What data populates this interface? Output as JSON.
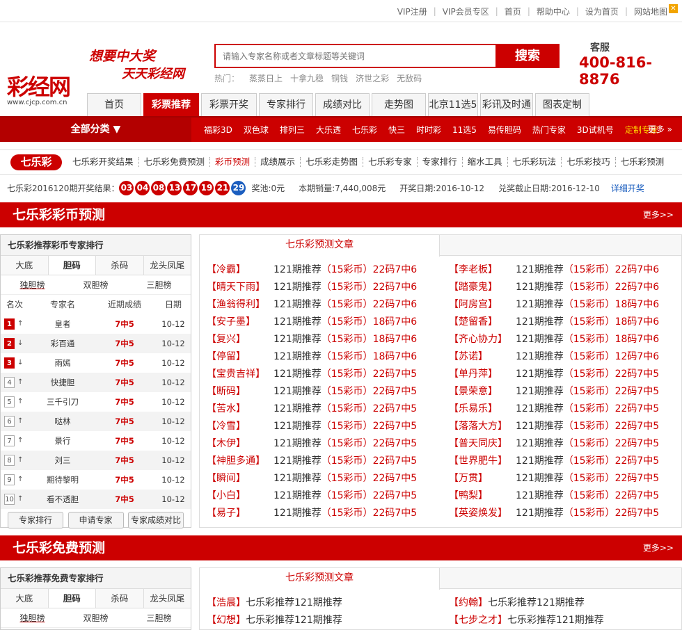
{
  "toplinks": [
    "VIP注册",
    "VIP会员专区",
    "首页",
    "帮助中心",
    "设为首页",
    "网站地图"
  ],
  "logo": {
    "text": "彩经网",
    "url": "www.cjcp.com.cn"
  },
  "slogan": [
    "想要中大奖",
    "天天彩经网"
  ],
  "search": {
    "placeholder": "请输入专家名称或者文章标题等关键词",
    "button": "搜索"
  },
  "hot": {
    "label": "热门：",
    "keywords": [
      "蒸蒸日上",
      "十拿九稳",
      "铜钱",
      "济世之彩",
      "无敌码"
    ]
  },
  "service": {
    "label": "客服",
    "phone": "400-816-8876"
  },
  "tabs": [
    {
      "label": "首页",
      "w": 78
    },
    {
      "label": "彩票推荐",
      "w": 80,
      "active": true
    },
    {
      "label": "彩票开奖",
      "w": 80
    },
    {
      "label": "专家排行",
      "w": 78
    },
    {
      "label": "成绩对比",
      "w": 78
    },
    {
      "label": "走势图",
      "w": 78
    },
    {
      "label": "北京11选5",
      "w": 72
    },
    {
      "label": "彩讯及时通",
      "w": 76
    },
    {
      "label": "图表定制",
      "w": 78
    }
  ],
  "allcat": "全部分类 ▼",
  "nav": [
    "福彩3D",
    "双色球",
    "排列三",
    "大乐透",
    "七乐彩",
    "快三",
    "时时彩",
    "11选5",
    "易传胆码",
    "热门专家",
    "3D试机号",
    "定制专家"
  ],
  "navmore": "更多 »",
  "badge": "七乐彩",
  "sublinks": [
    "七乐彩开奖结果",
    "七乐彩免费预测",
    "彩币预测",
    "成绩展示",
    "七乐彩走势图",
    "七乐彩专家",
    "专家排行",
    "缩水工具",
    "七乐彩玩法",
    "七乐彩技巧",
    "七乐彩预测"
  ],
  "draw": {
    "period": "七乐彩2016120期开奖结果：",
    "balls": [
      "03",
      "04",
      "08",
      "13",
      "17",
      "19",
      "21"
    ],
    "special": "29",
    "pool": "奖池:0元",
    "sales": "本期销量:7,440,008元",
    "date": "开奖日期:2016-10-12",
    "deadline": "兑奖截止日期:2016-12-10",
    "detail": "详细开奖"
  },
  "section1": {
    "title": "七乐彩彩币预测",
    "more": "更多>>"
  },
  "section2": {
    "title": "七乐彩免费预测",
    "more": "更多>>"
  },
  "panel1": {
    "title": "七乐彩推荐彩币专家排行",
    "tabs": [
      "大底",
      "胆码",
      "杀码",
      "龙头凤尾"
    ],
    "subtabs": [
      "独胆榜",
      "双胆榜",
      "三胆榜"
    ],
    "headers": [
      "名次",
      "专家名",
      "近期成绩",
      "日期"
    ],
    "rows": [
      {
        "rank": "1",
        "trend": "↑",
        "name": "皇者",
        "score": "7中5",
        "date": "10-12"
      },
      {
        "rank": "2",
        "trend": "↓",
        "name": "彩百通",
        "score": "7中5",
        "date": "10-12"
      },
      {
        "rank": "3",
        "trend": "↓",
        "name": "雨嫣",
        "score": "7中5",
        "date": "10-12"
      },
      {
        "rank": "4",
        "trend": "↑",
        "name": "快捷胆",
        "score": "7中5",
        "date": "10-12"
      },
      {
        "rank": "5",
        "trend": "↑",
        "name": "三千引刀",
        "score": "7中5",
        "date": "10-12"
      },
      {
        "rank": "6",
        "trend": "↑",
        "name": "哒林",
        "score": "7中5",
        "date": "10-12"
      },
      {
        "rank": "7",
        "trend": "↑",
        "name": "景行",
        "score": "7中5",
        "date": "10-12"
      },
      {
        "rank": "8",
        "trend": "↑",
        "name": "刘三",
        "score": "7中5",
        "date": "10-12"
      },
      {
        "rank": "9",
        "trend": "↑",
        "name": "期待黎明",
        "score": "7中5",
        "date": "10-12"
      },
      {
        "rank": "10",
        "trend": "↑",
        "name": "看不透胆",
        "score": "7中5",
        "date": "10-12"
      }
    ],
    "buttons": [
      "专家排行",
      "申请专家",
      "专家成绩对比"
    ]
  },
  "articles1": {
    "tab": "七乐彩预测文章",
    "left": [
      {
        "name": "【冷霸】",
        "p": "121期推荐",
        "c": "（15彩币）",
        "s": "22码7中6"
      },
      {
        "name": "【晴天下雨】",
        "p": "121期推荐",
        "c": "（15彩币）",
        "s": "22码7中6"
      },
      {
        "name": "【渔翁得利】",
        "p": "121期推荐",
        "c": "（15彩币）",
        "s": "22码7中6"
      },
      {
        "name": "【安子墨】",
        "p": "121期推荐",
        "c": "（15彩币）",
        "s": "18码7中6"
      },
      {
        "name": "【复兴】",
        "p": "121期推荐",
        "c": "（15彩币）",
        "s": "18码7中6"
      },
      {
        "name": "【停留】",
        "p": "121期推荐",
        "c": "（15彩币）",
        "s": "18码7中6"
      },
      {
        "name": "【宝贵吉祥】",
        "p": "121期推荐",
        "c": "（15彩币）",
        "s": "22码7中5"
      },
      {
        "name": "【断码】",
        "p": "121期推荐",
        "c": "（15彩币）",
        "s": "22码7中5"
      },
      {
        "name": "【苦水】",
        "p": "121期推荐",
        "c": "（15彩币）",
        "s": "22码7中5"
      },
      {
        "name": "【冷雪】",
        "p": "121期推荐",
        "c": "（15彩币）",
        "s": "22码7中5"
      },
      {
        "name": "【木伊】",
        "p": "121期推荐",
        "c": "（15彩币）",
        "s": "22码7中5"
      },
      {
        "name": "【神胆多通】",
        "p": "121期推荐",
        "c": "（15彩币）",
        "s": "22码7中5"
      },
      {
        "name": "【瞬间】",
        "p": "121期推荐",
        "c": "（15彩币）",
        "s": "22码7中5"
      },
      {
        "name": "【小白】",
        "p": "121期推荐",
        "c": "（15彩币）",
        "s": "22码7中5"
      },
      {
        "name": "【易子】",
        "p": "121期推荐",
        "c": "（15彩币）",
        "s": "22码7中5"
      }
    ],
    "right": [
      {
        "name": "【李老板】",
        "p": "121期推荐",
        "c": "（15彩币）",
        "s": "22码7中6"
      },
      {
        "name": "【踏豪鬼】",
        "p": "121期推荐",
        "c": "（15彩币）",
        "s": "22码7中6"
      },
      {
        "name": "【阿房宫】",
        "p": "121期推荐",
        "c": "（15彩币）",
        "s": "18码7中6"
      },
      {
        "name": "【楚留香】",
        "p": "121期推荐",
        "c": "（15彩币）",
        "s": "18码7中6"
      },
      {
        "name": "【齐心协力】",
        "p": "121期推荐",
        "c": "（15彩币）",
        "s": "18码7中6"
      },
      {
        "name": "【苏诺】",
        "p": "121期推荐",
        "c": "（15彩币）",
        "s": "12码7中6"
      },
      {
        "name": "【单丹萍】",
        "p": "121期推荐",
        "c": "（15彩币）",
        "s": "22码7中5"
      },
      {
        "name": "【景荣意】",
        "p": "121期推荐",
        "c": "（15彩币）",
        "s": "22码7中5"
      },
      {
        "name": "【乐易乐】",
        "p": "121期推荐",
        "c": "（15彩币）",
        "s": "22码7中5"
      },
      {
        "name": "【落落大方】",
        "p": "121期推荐",
        "c": "（15彩币）",
        "s": "22码7中5"
      },
      {
        "name": "【普天同庆】",
        "p": "121期推荐",
        "c": "（15彩币）",
        "s": "22码7中5"
      },
      {
        "name": "【世界肥牛】",
        "p": "121期推荐",
        "c": "（15彩币）",
        "s": "22码7中5"
      },
      {
        "name": "【万贯】",
        "p": "121期推荐",
        "c": "（15彩币）",
        "s": "22码7中5"
      },
      {
        "name": "【鸭梨】",
        "p": "121期推荐",
        "c": "（15彩币）",
        "s": "22码7中5"
      },
      {
        "name": "【英姿焕发】",
        "p": "121期推荐",
        "c": "（15彩币）",
        "s": "22码7中5"
      }
    ]
  },
  "panel2": {
    "title": "七乐彩推荐免费专家排行",
    "tabs": [
      "大底",
      "胆码",
      "杀码",
      "龙头凤尾"
    ],
    "subtabs": [
      "独胆榜",
      "双胆榜",
      "三胆榜"
    ]
  },
  "articles2": {
    "tab": "七乐彩预测文章",
    "left": [
      {
        "name": "【浩晨】",
        "t": "七乐彩推荐121期推荐"
      },
      {
        "name": "【幻想】",
        "t": "七乐彩推荐121期推荐"
      }
    ],
    "right": [
      {
        "name": "【约翰】",
        "t": "七乐彩推荐121期推荐"
      },
      {
        "name": "【七步之才】",
        "t": "七乐彩推荐121期推荐"
      }
    ]
  }
}
